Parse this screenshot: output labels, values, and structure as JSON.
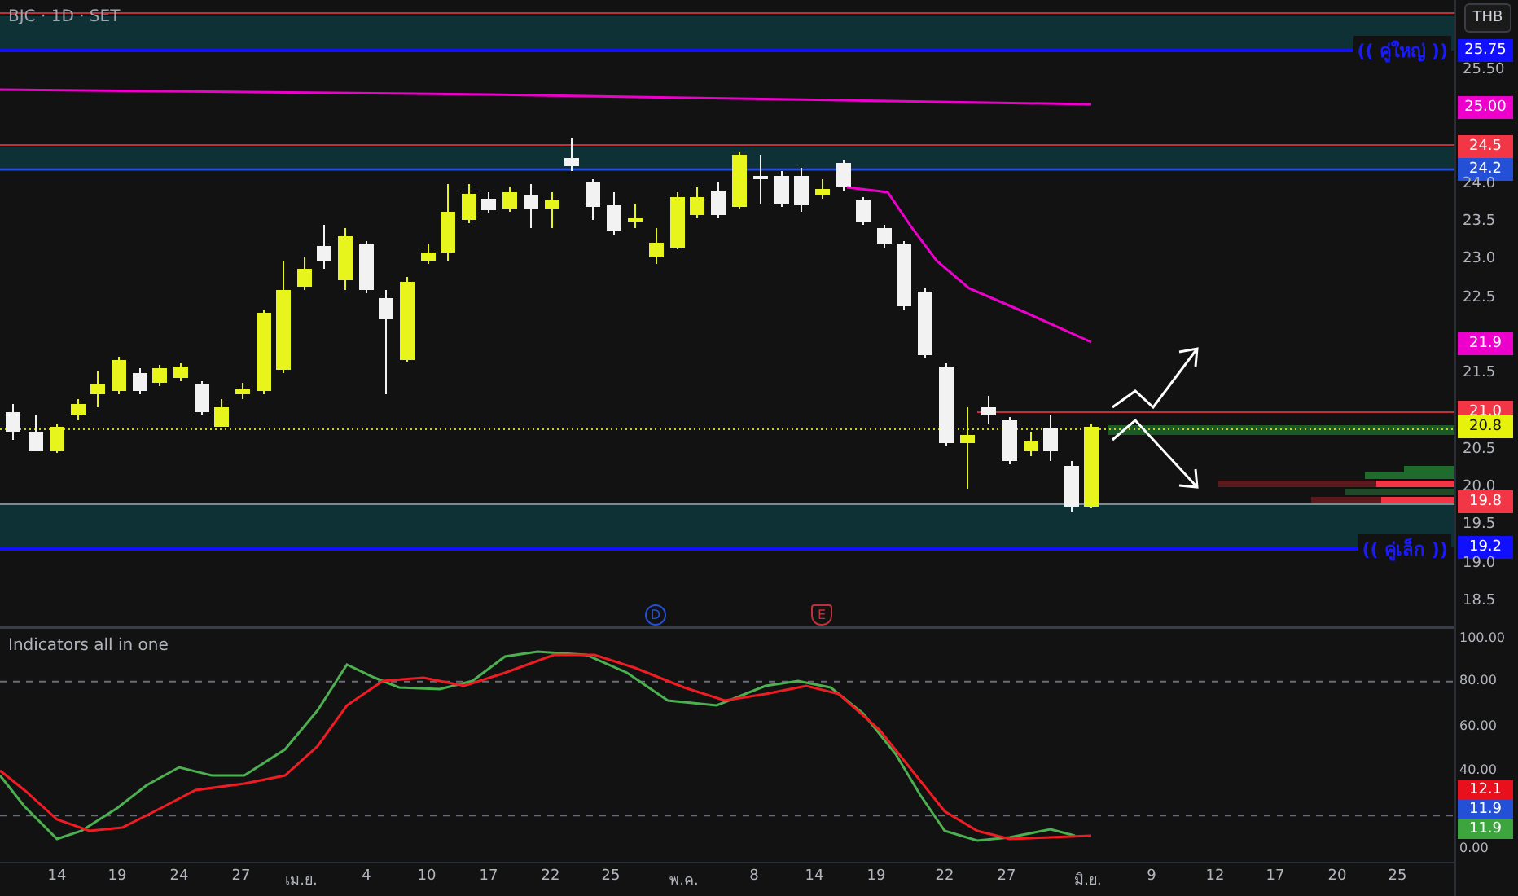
{
  "header": {
    "symbol": "BJC · 1D · SET",
    "currency_button": "THB"
  },
  "zone_labels": [
    "(( คู่ใหญ่ ))",
    "(( คู่เล็ก ))"
  ],
  "event_markers": [
    {
      "letter": "D",
      "kind": "dividend"
    },
    {
      "letter": "E",
      "kind": "earnings"
    }
  ],
  "price_axis": [
    {
      "text": "25.75",
      "kind": "badge",
      "color": "#1010ff"
    },
    {
      "text": "25.50",
      "kind": "tick"
    },
    {
      "text": "25.00",
      "kind": "badge",
      "color": "#ee00cc"
    },
    {
      "text": "24.5",
      "kind": "badge",
      "color": "#f23645"
    },
    {
      "text": "24.2",
      "kind": "badge",
      "color": "#2450d8"
    },
    {
      "text": "24.0",
      "kind": "tick"
    },
    {
      "text": "23.5",
      "kind": "tick"
    },
    {
      "text": "23.0",
      "kind": "tick"
    },
    {
      "text": "22.5",
      "kind": "tick"
    },
    {
      "text": "21.9",
      "kind": "badge",
      "color": "#ee00cc"
    },
    {
      "text": "21.5",
      "kind": "tick"
    },
    {
      "text": "21.0",
      "kind": "badge",
      "color": "#f23645"
    },
    {
      "text": "20.8",
      "kind": "badge",
      "color": "#e6f20a"
    },
    {
      "text": "20.5",
      "kind": "tick"
    },
    {
      "text": "20.0",
      "kind": "tick"
    },
    {
      "text": "19.8",
      "kind": "badge",
      "color": "#f23645"
    },
    {
      "text": "19.5",
      "kind": "tick"
    },
    {
      "text": "19.2",
      "kind": "badge",
      "color": "#1010ff"
    },
    {
      "text": "19.0",
      "kind": "tick"
    },
    {
      "text": "18.5",
      "kind": "tick"
    }
  ],
  "indicator": {
    "title": "Indicators all in one",
    "axis": [
      {
        "text": "100.00",
        "kind": "tick"
      },
      {
        "text": "80.00",
        "kind": "tick"
      },
      {
        "text": "60.00",
        "kind": "tick"
      },
      {
        "text": "40.00",
        "kind": "tick"
      },
      {
        "text": "12.1",
        "kind": "badge",
        "color": "#e8101c"
      },
      {
        "text": "11.9",
        "kind": "badge",
        "color": "#2450d8"
      },
      {
        "text": "11.9",
        "kind": "badge",
        "color": "#3da53d"
      },
      {
        "text": "0.00",
        "kind": "tick"
      }
    ]
  },
  "time_axis": [
    "14",
    "19",
    "24",
    "27",
    "เม.ย.",
    "4",
    "10",
    "17",
    "22",
    "25",
    "พ.ค.",
    "8",
    "14",
    "19",
    "22",
    "27",
    "มิ.ย.",
    "9",
    "12",
    "17",
    "20",
    "25"
  ]
}
